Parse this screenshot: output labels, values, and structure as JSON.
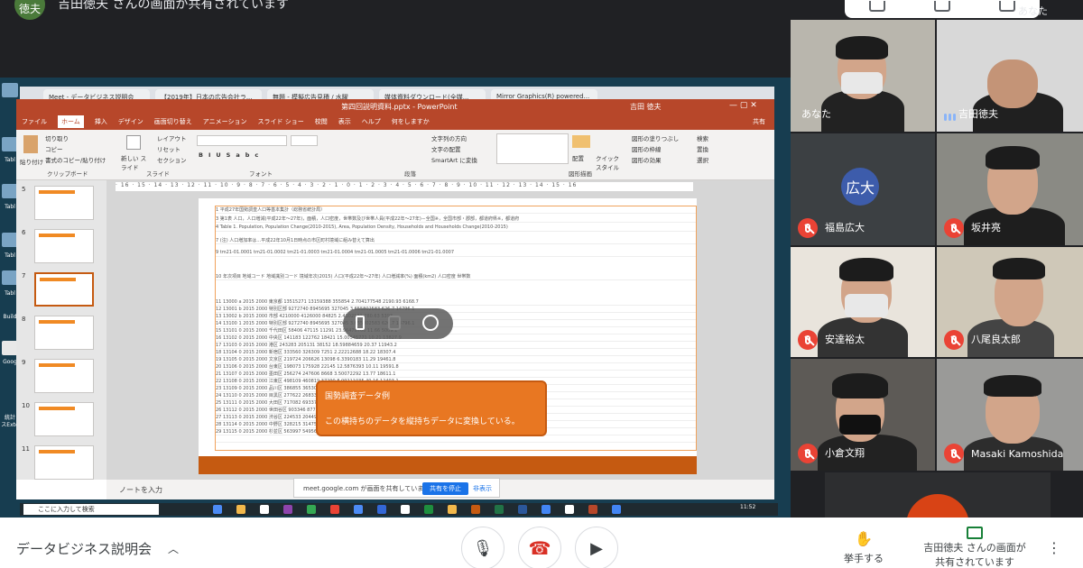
{
  "top": {
    "avatar": "徳夫",
    "banner": "吉田徳夫 さんの画面が共有されています",
    "you_label": "あなた"
  },
  "browser": {
    "tabs": [
      "Meet - データビジネス説明会",
      "【2019年】日本の広告会社ラ...",
      "無題 - 模擬広告見積 / 水曜",
      "媒体資料ダウンロード(全媒...",
      "Mirror Graphics(R) powered..."
    ]
  },
  "powerpoint": {
    "title": "第四回説明資料.pptx - PowerPoint",
    "user": "吉田 徳夫",
    "menu": [
      "ファイル",
      "ホーム",
      "挿入",
      "デザイン",
      "画面切り替え",
      "アニメーション",
      "スライド ショー",
      "校閲",
      "表示",
      "ヘルプ",
      "何をしますか"
    ],
    "share_label": "共有",
    "ribbon": {
      "clipboard": {
        "paste": "貼り付け",
        "cut": "切り取り",
        "copy": "コピー",
        "format": "書式のコピー/貼り付け",
        "group": "クリップボード"
      },
      "slides": {
        "new": "新しい スライド",
        "layout": "レイアウト",
        "reset": "リセット",
        "section": "セクション",
        "group": "スライド"
      },
      "font": {
        "group": "フォント"
      },
      "paragraph": {
        "dir": "文字列の方向",
        "align": "文字の配置",
        "smartart": "SmartArt に変換",
        "group": "段落"
      },
      "drawing": {
        "arrange": "配置",
        "quick": "クイック スタイル",
        "fill": "図形の塗りつぶし",
        "outline": "図形の枠線",
        "effect": "図形の効果",
        "group": "図形描画"
      },
      "editing": {
        "find": "検索",
        "replace": "置換",
        "select": "選択"
      }
    },
    "thumb_numbers": [
      "5",
      "6",
      "7",
      "8",
      "9",
      "10",
      "11"
    ],
    "ruler": "· 16 · 15 · 14 · 13 · 12 · 11 · 10 · 9 · 8 · 7 · 6 · 5 · 4 · 3 · 2 · 1 · 0 · 1 · 2 · 3 · 4 · 5 · 6 · 7 · 8 · 9 · 10 · 11 · 12 · 13 · 14 · 15 · 16",
    "notes": "ノートを入力",
    "callout_title": "国勢調査データ例",
    "callout_body": "この横持ちのデータを縦持ちデータに変換している。",
    "sheet_rows": [
      "1  平成27年国勢調査人口等基本集計（総務省統計局）",
      "3                                                               第1表  人口，人口増減(平成22年～27年)，面積，人口密度，世帯数及び世帯人員(平成22年～27年)－全国※，全国市部・郡部，都道府県※，都道府",
      "4                                                               Table 1. Population, Population Change(2010-2015), Area, Population Density, Households and Households Change(2010-2015)",
      "7                                                               (注) 人口増加率は…平成22年10月1日時点の市区町村境域に組み替えて算出",
      "9                                                               tm21-01.0001 tm21-01.0002 tm21-01.0003 tm21-01.0004 tm21-01.0005 tm21-01.0006 tm21-01.0007",
      "10  年次項目  地域コード  地域識別コード  境域年次(2015)    人口(平成22年～27年)  人口増減率(%)  面積(km2)  人口密度  世帯数",
      "11                 13000  a          2015   2000 東京都       13515271   13159388    355854   2.704177548     2190.93   6168.7",
      "12                 13001  b          2015   2000 特別区部       9272740    8945695    327045   3.655802583     626.7    14796.1",
      "13                 13002  b          2015   2000 市部        4210000    4126000    84825   2.4102131     780.63    5393",
      "14                 13100  1          2015   2000 特別区部       9272740    8945695    327045   3.655802583    626.7    14796.1",
      "15                 13101  0          2015   2000 千代田区       58406     47115     11291   23.96476706    11.66    5009.1",
      "16                 13102  0          2015   2000 中央区        141183    122762    18421   15.00545771    10.21    13827.9",
      "17                 13103  0          2015   2000 港区         243283    205131    38152   18.59884659    20.37    11943.2",
      "18                 13104  0          2015   2000 新宿区       333560    326309    7251   2.22212688    18.22    18307.4",
      "19                 13105  0          2015   2000 文京区       219724    206626    13098   6.3390183    11.29    19461.8",
      "20                 13106  0          2015   2000 台東区       198073    175928    22145   12.5876393    10.11    19591.8",
      "21                 13107  0          2015   2000 墨田区       256274    247606    8668   3.50072292    13.77    18611.1",
      "22                 13108  0          2015   2000 江東区       498109    460819    37290   8.09211035    40.16    12403.1",
      "23                 13109  0          2015   2000 品川区       386855    365302    21553   5.90007228    22.84    16937.6",
      "24                 13110  0          2015   2000 目黒区       277622    268330    9292   3.46289271    14.67    18924.5",
      "25                 13111  0          2015   2000 大田区       717082    693373    23709   3.41943   60.83    11788.3",
      "26                 13112  0          2015   2000 世田谷区      903346    877138    26208   2.98790   58.05    15561.5",
      "27                 13113  0          2015   2000 渋谷区       224533    204492    20041   9.80028   15.11    14859.9",
      "28                 13114  0          2015   2000 中野区       328215    314750    13465   4.27798   15.59    21052.9",
      "29                 13115  0          2015   2000 杉並区       563997    549569    14428   2.62533   34.06    16558.9"
    ]
  },
  "share_bar": {
    "text": "meet.google.com が画面を共有しています。",
    "stop": "共有を停止",
    "hide": "非表示"
  },
  "taskbar": {
    "search": "ここに入力して検索",
    "time": "11:52"
  },
  "desktop_labels": [
    "Tabl",
    "Tabl",
    "Tabl",
    "Tabl",
    "Build",
    "Goog",
    "統計",
    "スExte"
  ],
  "participants": [
    {
      "name": "あなた"
    },
    {
      "name": "吉田徳夫"
    },
    {
      "name": "福島広大",
      "initials": "広大"
    },
    {
      "name": "坂井亮"
    },
    {
      "name": "安達裕太"
    },
    {
      "name": "八尾良太郎"
    },
    {
      "name": "小倉文翔"
    },
    {
      "name": "Masaki Kamoshida"
    }
  ],
  "bottom": {
    "meeting_title": "データビジネス説明会",
    "raise_hand": "挙手する",
    "presenting": "吉田徳夫 さんの画面が共有されています"
  }
}
